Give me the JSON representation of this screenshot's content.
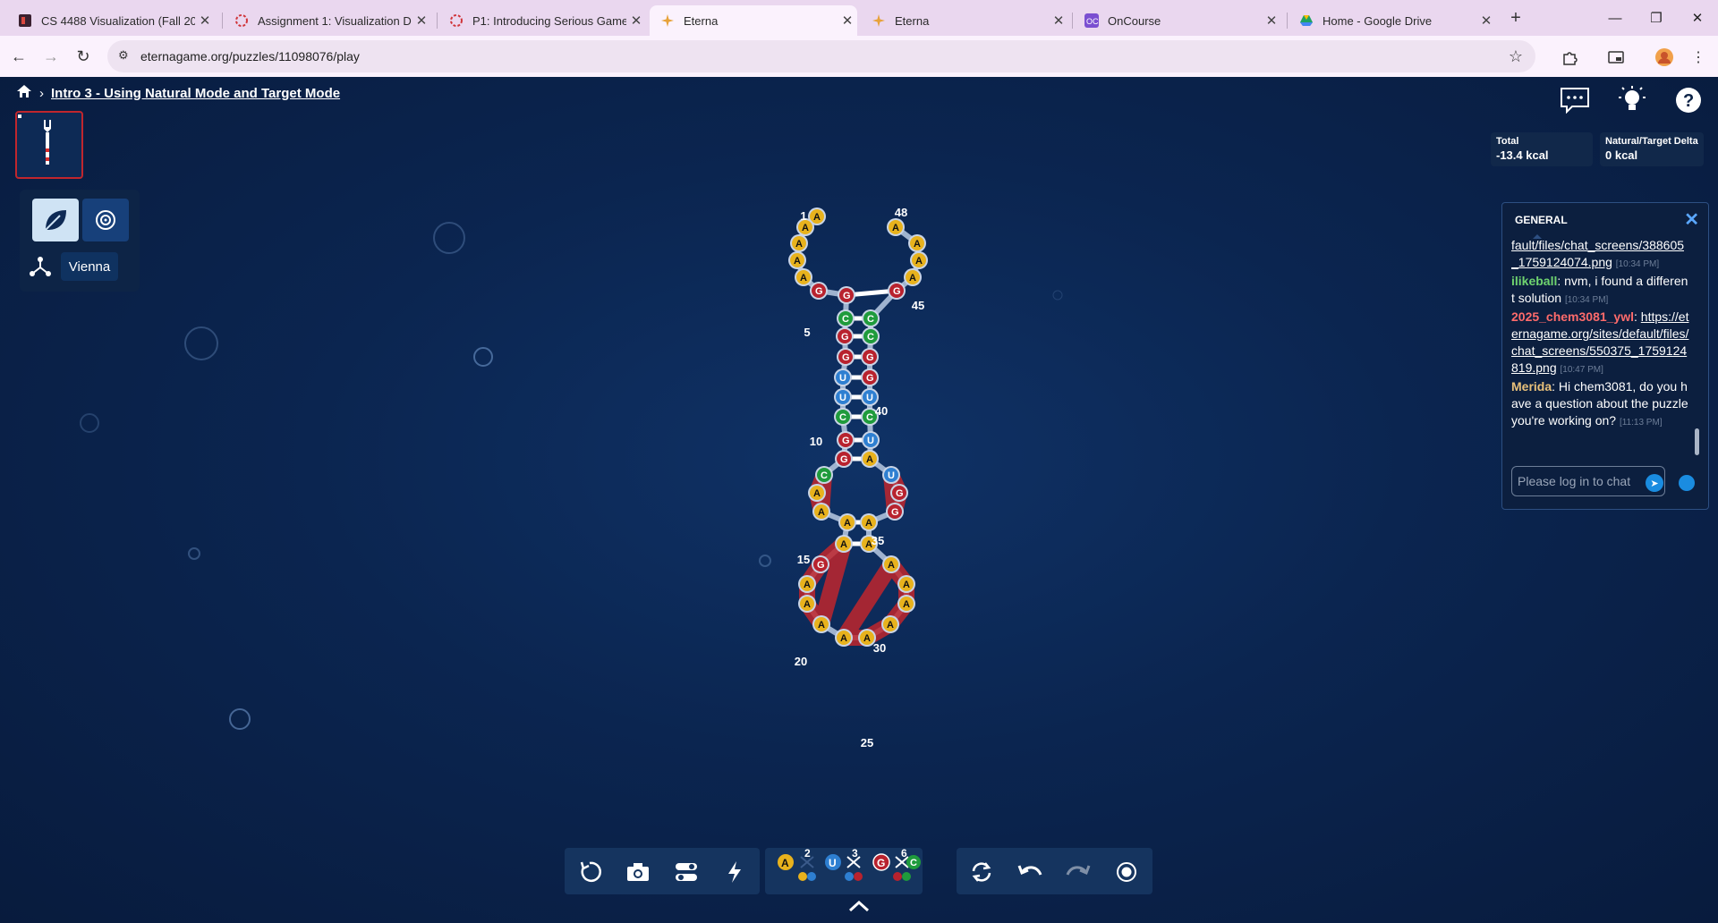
{
  "browser": {
    "tabs": [
      {
        "title": "CS 4488 Visualization (Fall 2025",
        "active": false
      },
      {
        "title": "Assignment 1: Visualization De",
        "active": false
      },
      {
        "title": "P1: Introducing Serious Games",
        "active": false
      },
      {
        "title": "Eterna",
        "active": true
      },
      {
        "title": "Eterna",
        "active": false
      },
      {
        "title": "OnCourse",
        "active": false
      },
      {
        "title": "Home - Google Drive",
        "active": false
      }
    ],
    "url": "eternagame.org/puzzles/11098076/play"
  },
  "game": {
    "breadcrumb_title": "Intro 3 - Using Natural Mode and Target Mode",
    "mode": "Vienna",
    "energy": {
      "total_label": "Total",
      "total_value": "-13.4 kcal",
      "delta_label": "Natural/Target Delta",
      "delta_value": "0 kcal"
    },
    "base_counts": {
      "pair_au": "2",
      "pair_gu": "3",
      "pair_gc": "6"
    }
  },
  "structure": {
    "sequence": "AAAAAGGCGGUUCGGCAAAAGAAAAAAAAAAAGGUAUCUGGCCGAAAAAAAA",
    "numbers": [
      {
        "label": "1"
      },
      {
        "label": "5"
      },
      {
        "label": "10"
      },
      {
        "label": "15"
      },
      {
        "label": "20"
      },
      {
        "label": "25"
      },
      {
        "label": "30"
      },
      {
        "label": "35"
      },
      {
        "label": "40"
      },
      {
        "label": "45"
      },
      {
        "label": "48"
      }
    ],
    "colors": {
      "A": "#e8b21d",
      "U": "#2e7fd1",
      "G": "#b8222e",
      "C": "#1f9b3c",
      "highlight": "#c0262d"
    }
  },
  "chat": {
    "channel": "GENERAL",
    "messages": [
      {
        "user": "",
        "user_color": "",
        "text": "",
        "link": "fault/files/chat_screens/388605_1759124074.png",
        "time": "[10:34 PM]"
      },
      {
        "user": "ilikeball",
        "user_color": "#6fd46f",
        "text": ": nvm, i found a different solution",
        "link": "",
        "time": "[10:34 PM]"
      },
      {
        "user": "2025_chem3081_ywl",
        "user_color": "#ff6b6b",
        "text": ":",
        "link": "https://eternagame.org/sites/default/files/chat_screens/550375_1759124819.png",
        "time": "[10:47 PM]"
      },
      {
        "user": "Merida",
        "user_color": "#e8c07a",
        "text": ": Hi chem3081, do you have a question about the puzzle you're working on?",
        "link": "",
        "time": "[11:13 PM]"
      }
    ],
    "input_placeholder": "Please log in to chat"
  }
}
